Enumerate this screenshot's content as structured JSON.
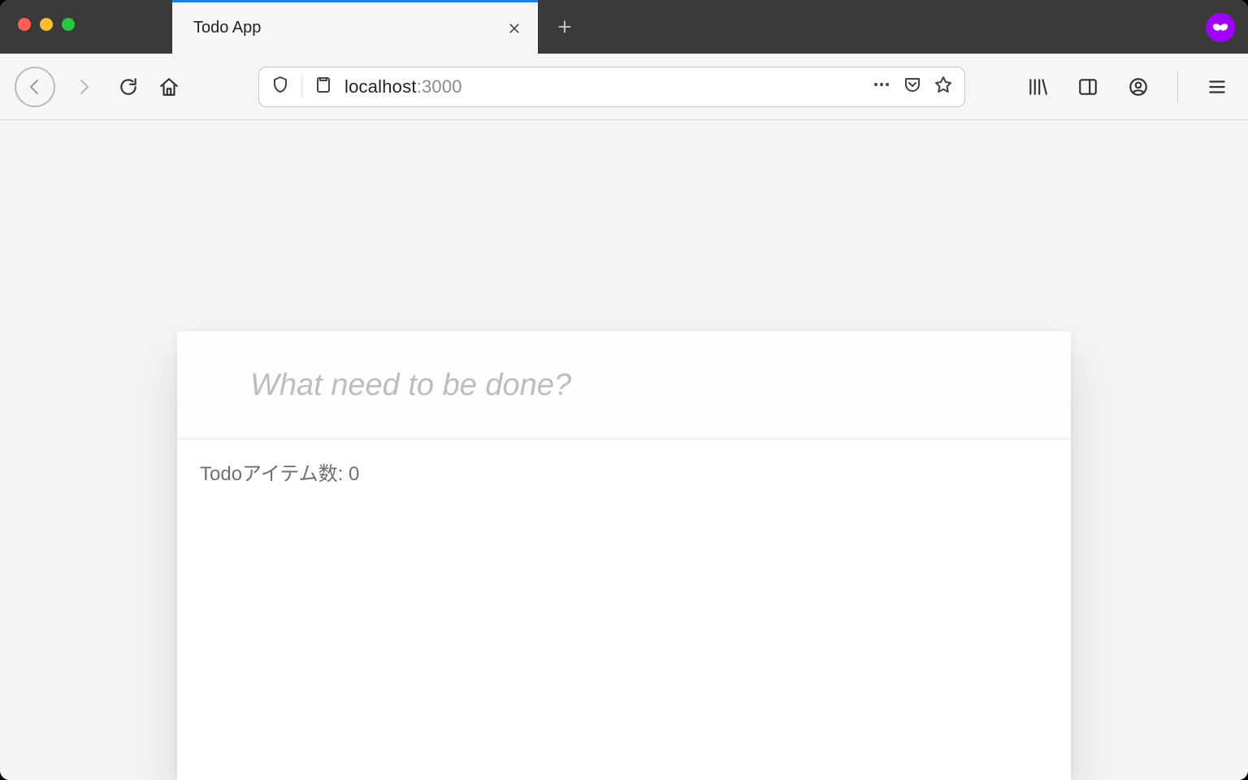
{
  "browser": {
    "tab_title": "Todo App",
    "url_host": "localhost",
    "url_port": ":3000"
  },
  "todo": {
    "input_placeholder": "What need to be done?",
    "count_label": "Todoアイテム数: 0"
  }
}
